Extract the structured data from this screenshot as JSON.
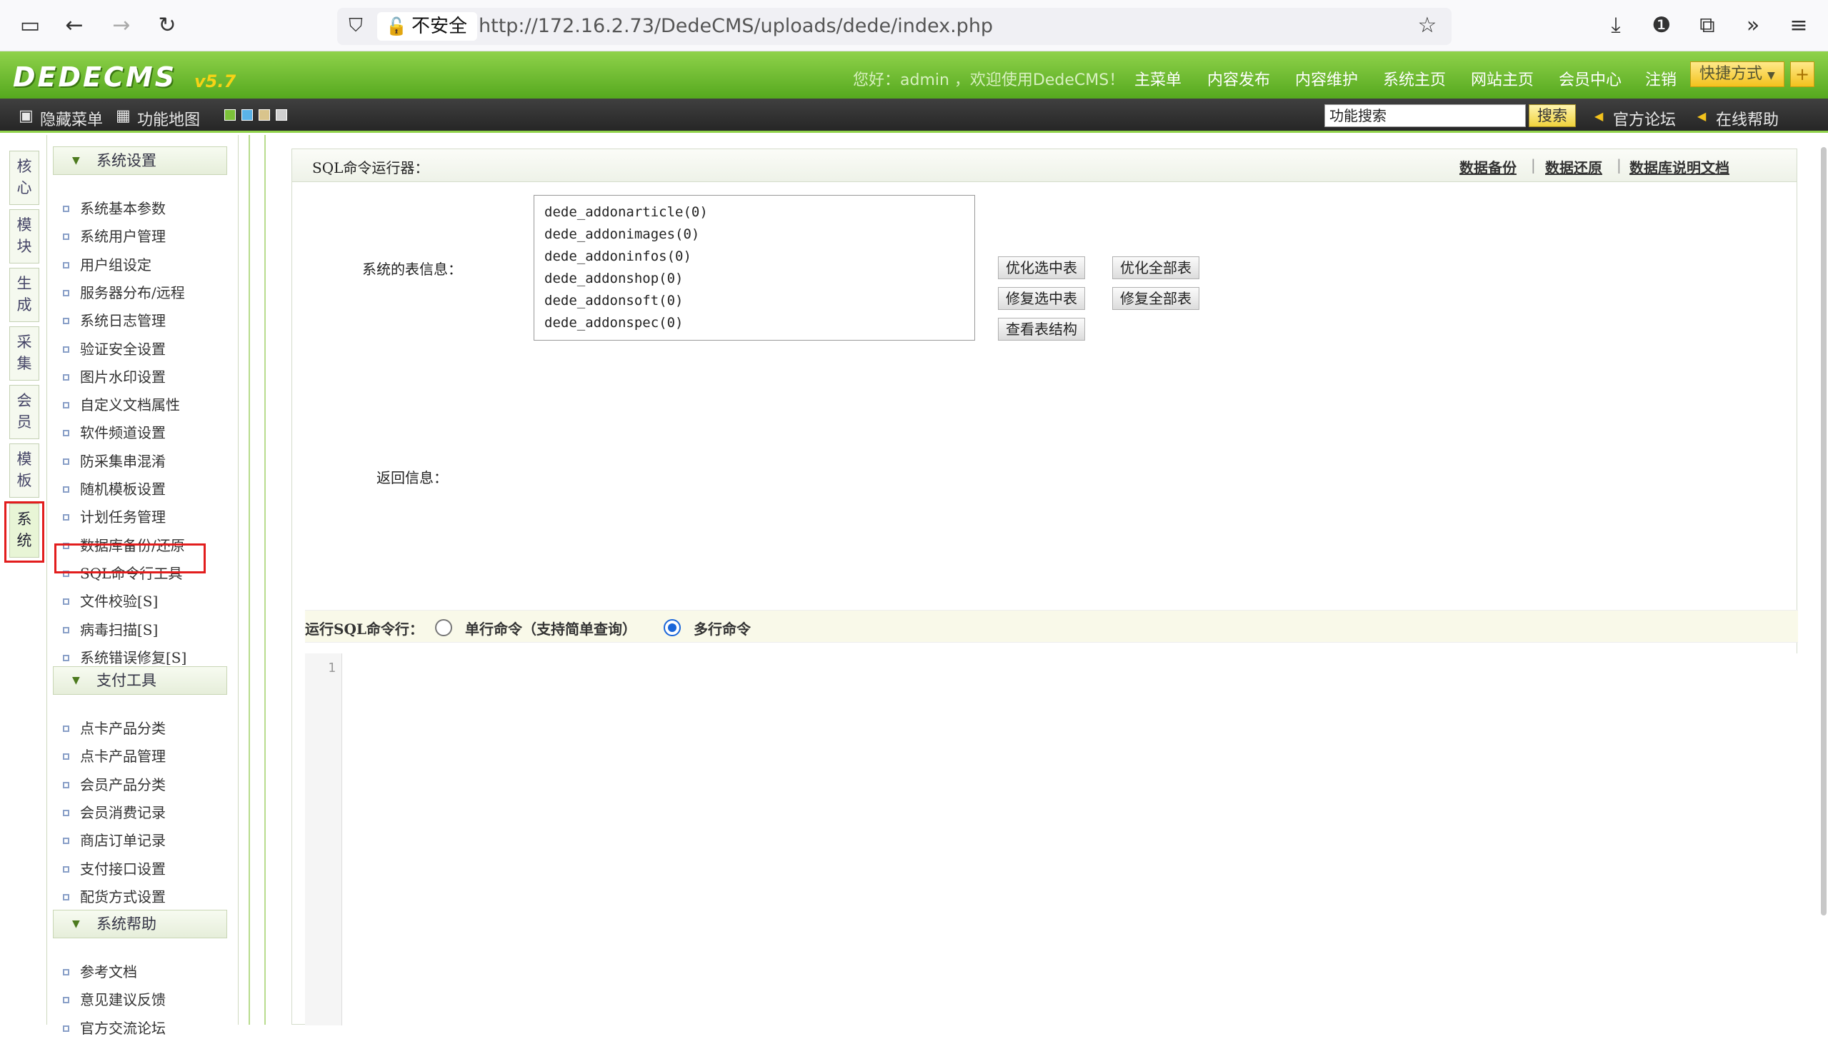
{
  "browser": {
    "security_label": "不安全",
    "url": "http://172.16.2.73/DedeCMS/uploads/dede/index.php"
  },
  "header": {
    "logo": "DEDECMS",
    "version": "v5.7",
    "welcome": "您好：admin ，欢迎使用DedeCMS！",
    "nav": [
      "主菜单",
      "内容发布",
      "内容维护",
      "系统主页",
      "网站主页",
      "会员中心",
      "注销"
    ],
    "quick_label": "快捷方式",
    "quick_add": "+"
  },
  "toolbar": {
    "hide_menu": "隐藏菜单",
    "func_map": "功能地图",
    "search_value": "功能搜索",
    "search_button": "搜索",
    "forum": "官方论坛",
    "help": "在线帮助"
  },
  "vtabs": [
    "核心",
    "模块",
    "生成",
    "采集",
    "会员",
    "模板",
    "系统"
  ],
  "sidebar": {
    "groups": [
      {
        "title": "系统设置",
        "items": [
          "系统基本参数",
          "系统用户管理",
          "用户组设定",
          "服务器分布/远程",
          "系统日志管理",
          "验证安全设置",
          "图片水印设置",
          "自定义文档属性",
          "软件频道设置",
          "防采集串混淆",
          "随机模板设置",
          "计划任务管理",
          "数据库备份/还原",
          "SQL命令行工具",
          "文件校验[S]",
          "病毒扫描[S]",
          "系统错误修复[S]"
        ]
      },
      {
        "title": "支付工具",
        "items": [
          "点卡产品分类",
          "点卡产品管理",
          "会员产品分类",
          "会员消费记录",
          "商店订单记录",
          "支付接口设置",
          "配货方式设置"
        ]
      },
      {
        "title": "系统帮助",
        "items": [
          "参考文档",
          "意见建议反馈",
          "官方交流论坛"
        ]
      }
    ]
  },
  "main": {
    "title": "SQL命令运行器：",
    "links": [
      "数据备份",
      "数据还原",
      "数据库说明文档"
    ],
    "table_info_label": "系统的表信息：",
    "tables": [
      "dede_addonarticle(0)",
      "dede_addonimages(0)",
      "dede_addoninfos(0)",
      "dede_addonshop(0)",
      "dede_addonsoft(0)",
      "dede_addonspec(0)"
    ],
    "buttons": {
      "optimize_selected": "优化选中表",
      "optimize_all": "优化全部表",
      "repair_selected": "修复选中表",
      "repair_all": "修复全部表",
      "view_structure": "查看表结构"
    },
    "return_info_label": "返回信息：",
    "sql_label": "运行SQL命令行：",
    "single_cmd": "单行命令（支持简单查询）",
    "multi_cmd": "多行命令",
    "line_number": "1"
  }
}
